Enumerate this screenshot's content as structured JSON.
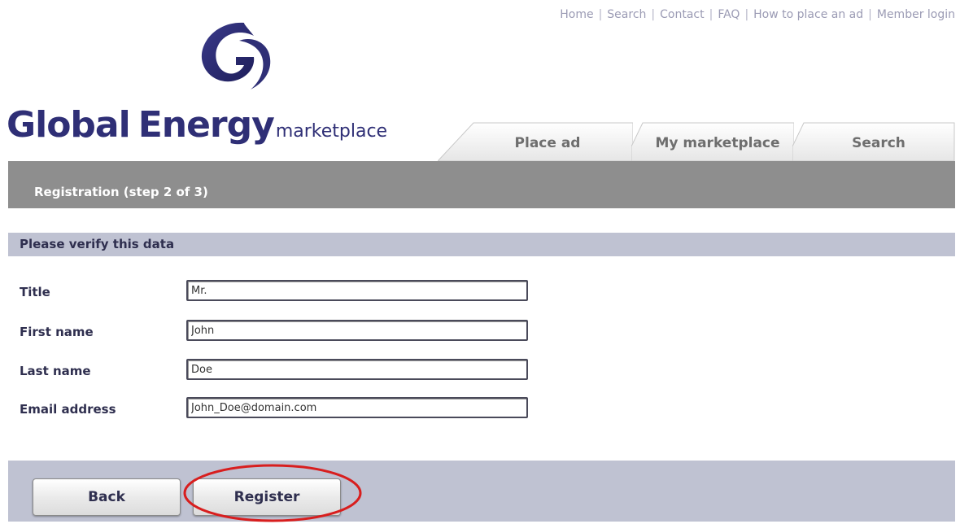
{
  "topnav": {
    "items": [
      "Home",
      "Search",
      "Contact",
      "FAQ",
      "How to place an ad",
      "Member login"
    ],
    "separator": "|"
  },
  "logo": {
    "word1": "Global",
    "word2": "Energy",
    "word3": "marketplace",
    "brand_color": "#2f2f76"
  },
  "tabs": [
    "Place ad",
    "My marketplace",
    "Search"
  ],
  "step": {
    "title": "Registration (step 2 of 3)"
  },
  "section": {
    "title": "Please verify this data"
  },
  "form": {
    "fields": [
      {
        "label": "Title",
        "value": "Mr."
      },
      {
        "label": "First name",
        "value": "John"
      },
      {
        "label": "Last name",
        "value": "Doe"
      },
      {
        "label": "Email address",
        "value": "John_Doe@domain.com"
      }
    ]
  },
  "actions": {
    "back_label": "Back",
    "register_label": "Register",
    "highlight_color": "#d81e1e"
  }
}
